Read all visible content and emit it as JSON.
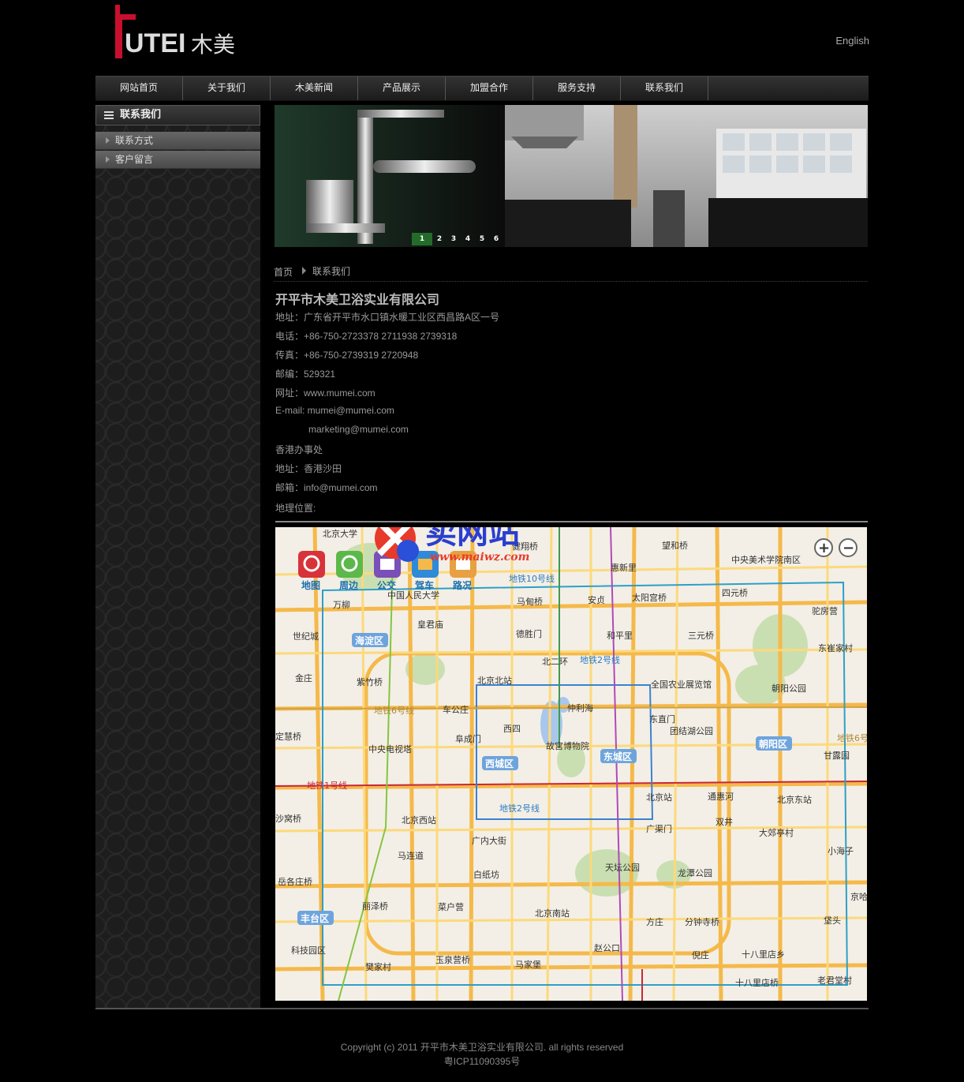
{
  "header": {
    "logo_text": "UTEI",
    "logo_cn": "木美",
    "language_link": "English"
  },
  "nav": {
    "items": [
      "网站首页",
      "关于我们",
      "木美新闻",
      "产品展示",
      "加盟合作",
      "服务支持",
      "联系我们"
    ]
  },
  "sidebar": {
    "title": "联系我们",
    "items": [
      "联系方式",
      "客户留言"
    ]
  },
  "banner": {
    "slides": [
      "1",
      "2",
      "3",
      "4",
      "5",
      "6"
    ],
    "active_slide": "1"
  },
  "breadcrumb": {
    "home": "首页",
    "current": "联系我们"
  },
  "contact": {
    "company": "开平市木美卫浴实业有限公司",
    "address": "地址：广东省开平市水口镇水暖工业区西昌路A区一号",
    "phone": "电话：+86-750-2723378 2711938 2739318",
    "fax": "传真：+86-750-2739319 2720948",
    "postcode": "邮编：529321",
    "website": "网址：www.mumei.com",
    "email_label": "E-mail: ",
    "email1": "mumei@mumei.com",
    "email2": "marketing@mumei.com",
    "hk_office": "香港办事处",
    "hk_address": "地址：香港沙田",
    "hk_email": "邮箱：info@mumei.com",
    "location_label": "地理位置:"
  },
  "map": {
    "tools": [
      "地图",
      "周边",
      "公交",
      "驾车",
      "路况"
    ],
    "watermark": "卖网站",
    "watermark_url": "www.maiwz.com",
    "zoom_in": "+",
    "zoom_out": "−",
    "labels": {
      "districts": [
        "海淀区",
        "西城区",
        "东城区",
        "朝阳区",
        "丰台区"
      ],
      "places": [
        "北京大学",
        "万柳",
        "世纪城",
        "金庄",
        "紫竹桥",
        "中国人民大学",
        "皇君庙",
        "马甸桥",
        "德胜门",
        "健翔桥",
        "惠新里",
        "安贞",
        "太阳宫桥",
        "望和桥",
        "中央美术学院南区",
        "四元桥",
        "驼房营",
        "东崔家村",
        "和平里",
        "三元桥",
        "北二环",
        "全国农业展览馆",
        "朝阳公园",
        "东直门",
        "仲利海",
        "车公庄",
        "西四",
        "北京北站",
        "阜成门",
        "故宫博物院",
        "团结湖公园",
        "中央电视塔",
        "定慧桥",
        "甘露园",
        "北京站",
        "通惠河",
        "北京东站",
        "广渠门",
        "双井",
        "大郊亭村",
        "小海子",
        "北京西站",
        "沙窝桥",
        "广内大街",
        "马连道",
        "白纸坊",
        "天坛公园",
        "龙潭公园",
        "岳各庄桥",
        "丽泽桥",
        "菜户营",
        "北京南站",
        "方庄",
        "分钟寺桥",
        "垡头",
        "科技园区",
        "樊家村",
        "玉泉营桥",
        "马家堡",
        "赵公口",
        "倪庄",
        "十八里店乡",
        "十八里店桥",
        "老君堂村",
        "京哈"
      ],
      "lines": [
        "地铁10号线",
        "地铁2号线",
        "地铁6号线",
        "地铁1号线",
        "地铁8号线",
        "地铁5号线",
        "地铁4号线"
      ]
    }
  },
  "footer": {
    "copyright": "Copyright (c) 2011 开平市木美卫浴实业有限公司. all rights reserved",
    "icp": "粤ICP11090395号"
  }
}
